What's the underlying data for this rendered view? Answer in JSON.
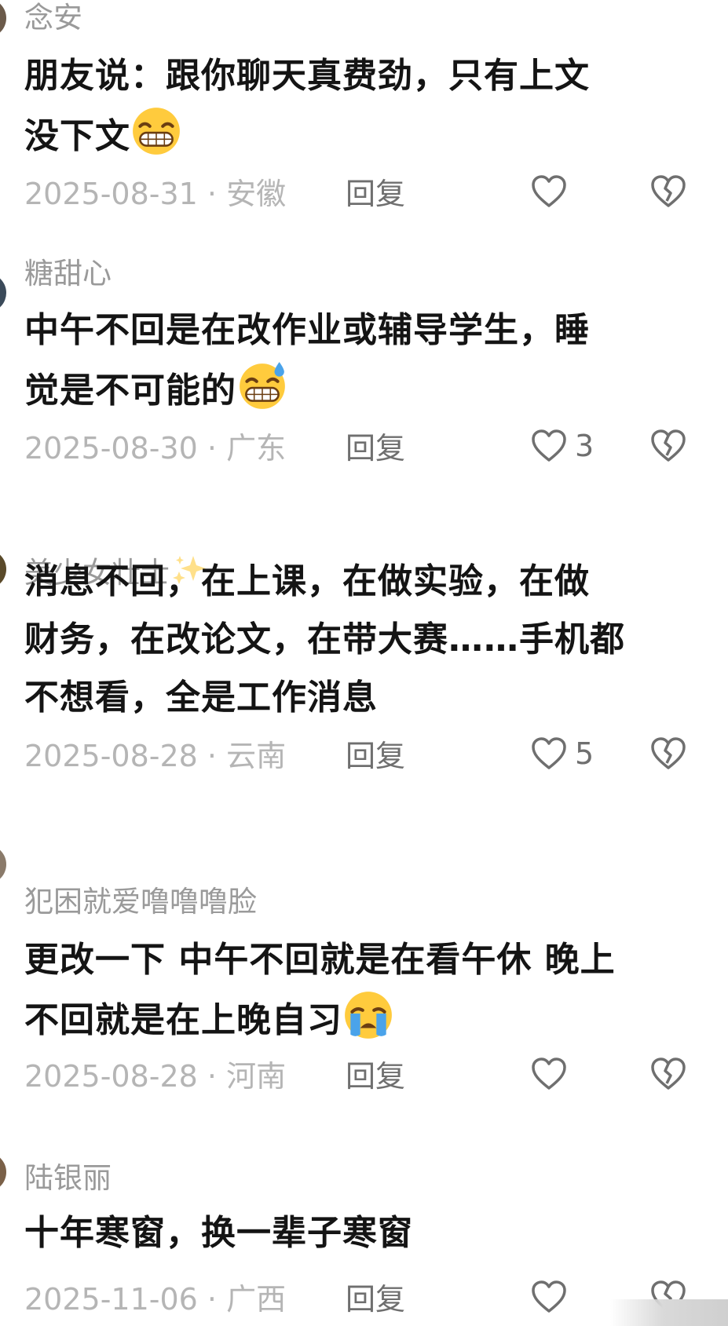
{
  "comments": [
    {
      "username": "念安",
      "text_lines": [
        "朋友说：跟你聊天真费劲，只有上文",
        "没下文"
      ],
      "emoji": "grinning-face-icon",
      "date_location": "2025-08-31 · 安徽",
      "reply_label": "回复",
      "like_count": ""
    },
    {
      "username": "糖甜心",
      "text_lines": [
        "中午不回是在改作业或辅导学生，睡",
        "觉是不可能的"
      ],
      "emoji": "grinning-face-with-sweat-icon",
      "date_location": "2025-08-30 · 广东",
      "reply_label": "回复",
      "like_count": "3"
    },
    {
      "username": "美少女壮士",
      "username_emoji": "sparkles-icon",
      "text_lines": [
        "消息不回，在上课，在做实验，在做",
        "财务，在改论文，在带大赛……手机都",
        "不想看，全是工作消息"
      ],
      "date_location": "2025-08-28 · 云南",
      "reply_label": "回复",
      "like_count": "5"
    },
    {
      "username": "犯困就爱噜噜噜脸",
      "text_lines": [
        "更改一下 中午不回就是在看午休 晚上",
        "不回就是在上晚自习"
      ],
      "emoji": "loudly-crying-face-icon",
      "date_location": "2025-08-28 · 河南",
      "reply_label": "回复",
      "like_count": ""
    },
    {
      "username": "陆银丽",
      "text_lines": [
        "十年寒窗，换一辈子寒窗"
      ],
      "date_location": "2025-11-06 · 广西",
      "reply_label": "回复",
      "like_count": ""
    }
  ],
  "colors": {
    "username": "#9a9a9a",
    "body_text": "#141414",
    "meta": "#b5b5b5",
    "action": "#6f6f6f"
  }
}
